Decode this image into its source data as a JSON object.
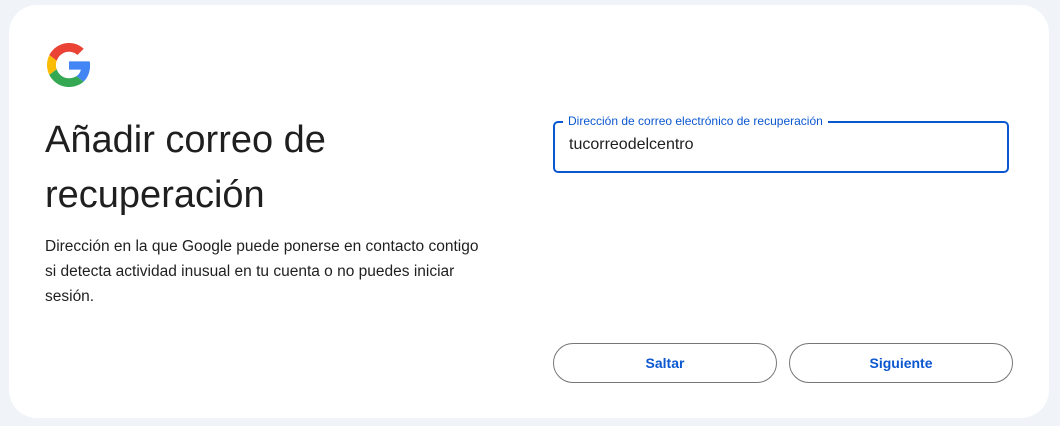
{
  "logo": {
    "icon": "google-g-icon",
    "colors": [
      "#4285f4",
      "#34a853",
      "#fbbc05",
      "#ea4335"
    ]
  },
  "heading": {
    "line1": "Añadir correo de",
    "line2": "recuperación"
  },
  "description": {
    "line1": "Dirección en la que Google puede ponerse en contacto contigo",
    "line2": "si detecta actividad inusual en tu cuenta o no puedes iniciar",
    "line3": "sesión."
  },
  "recovery_email": {
    "label": "Dirección de correo electrónico de recuperación",
    "value": "tucorreodelcentro"
  },
  "buttons": {
    "skip": "Saltar",
    "next": "Siguiente"
  },
  "colors": {
    "accent": "#0b57d0",
    "text": "#1f1f1f",
    "page_background": "#f0f4f9",
    "card": "#ffffff"
  }
}
